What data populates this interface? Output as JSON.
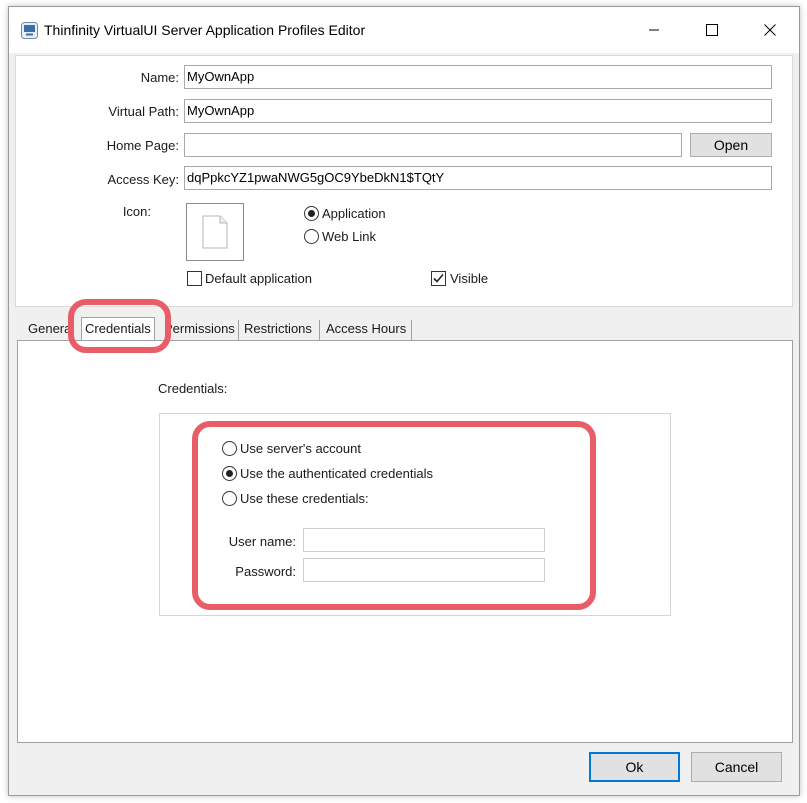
{
  "window": {
    "title": "Thinfinity VirtualUI Server Application Profiles Editor",
    "controls": {
      "minimize": "minimize",
      "maximize": "maximize",
      "close": "close"
    }
  },
  "form": {
    "name_label": "Name:",
    "name_value": "MyOwnApp",
    "virtual_path_label": "Virtual Path:",
    "virtual_path_value": "MyOwnApp",
    "home_page_label": "Home Page:",
    "home_page_value": "",
    "open_button": "Open",
    "access_key_label": "Access Key:",
    "access_key_value": "dqPpkcYZ1pwaNWG5gOC9YbeDkN1$TQtY",
    "icon_label": "Icon:",
    "type_options": [
      {
        "label": "Application",
        "selected": true
      },
      {
        "label": "Web Link",
        "selected": false
      }
    ],
    "default_application_label": "Default application",
    "default_application_checked": false,
    "visible_label": "Visible",
    "visible_checked": true
  },
  "tabs": [
    {
      "label": "General",
      "active": false
    },
    {
      "label": "Credentials",
      "active": true
    },
    {
      "label": "Permissions",
      "active": false
    },
    {
      "label": "Restrictions",
      "active": false
    },
    {
      "label": "Access Hours",
      "active": false
    }
  ],
  "credentials": {
    "section_label": "Credentials:",
    "options": [
      {
        "label": "Use server's account",
        "selected": false
      },
      {
        "label": "Use the authenticated credentials",
        "selected": true
      },
      {
        "label": "Use these credentials:",
        "selected": false
      }
    ],
    "username_label": "User name:",
    "username_value": "",
    "password_label": "Password:",
    "password_value": ""
  },
  "footer": {
    "ok_button": "Ok",
    "cancel_button": "Cancel"
  },
  "colors": {
    "highlight": "#e85d68",
    "window_bg": "#f0f0f0",
    "ok_border": "#0078d7"
  }
}
